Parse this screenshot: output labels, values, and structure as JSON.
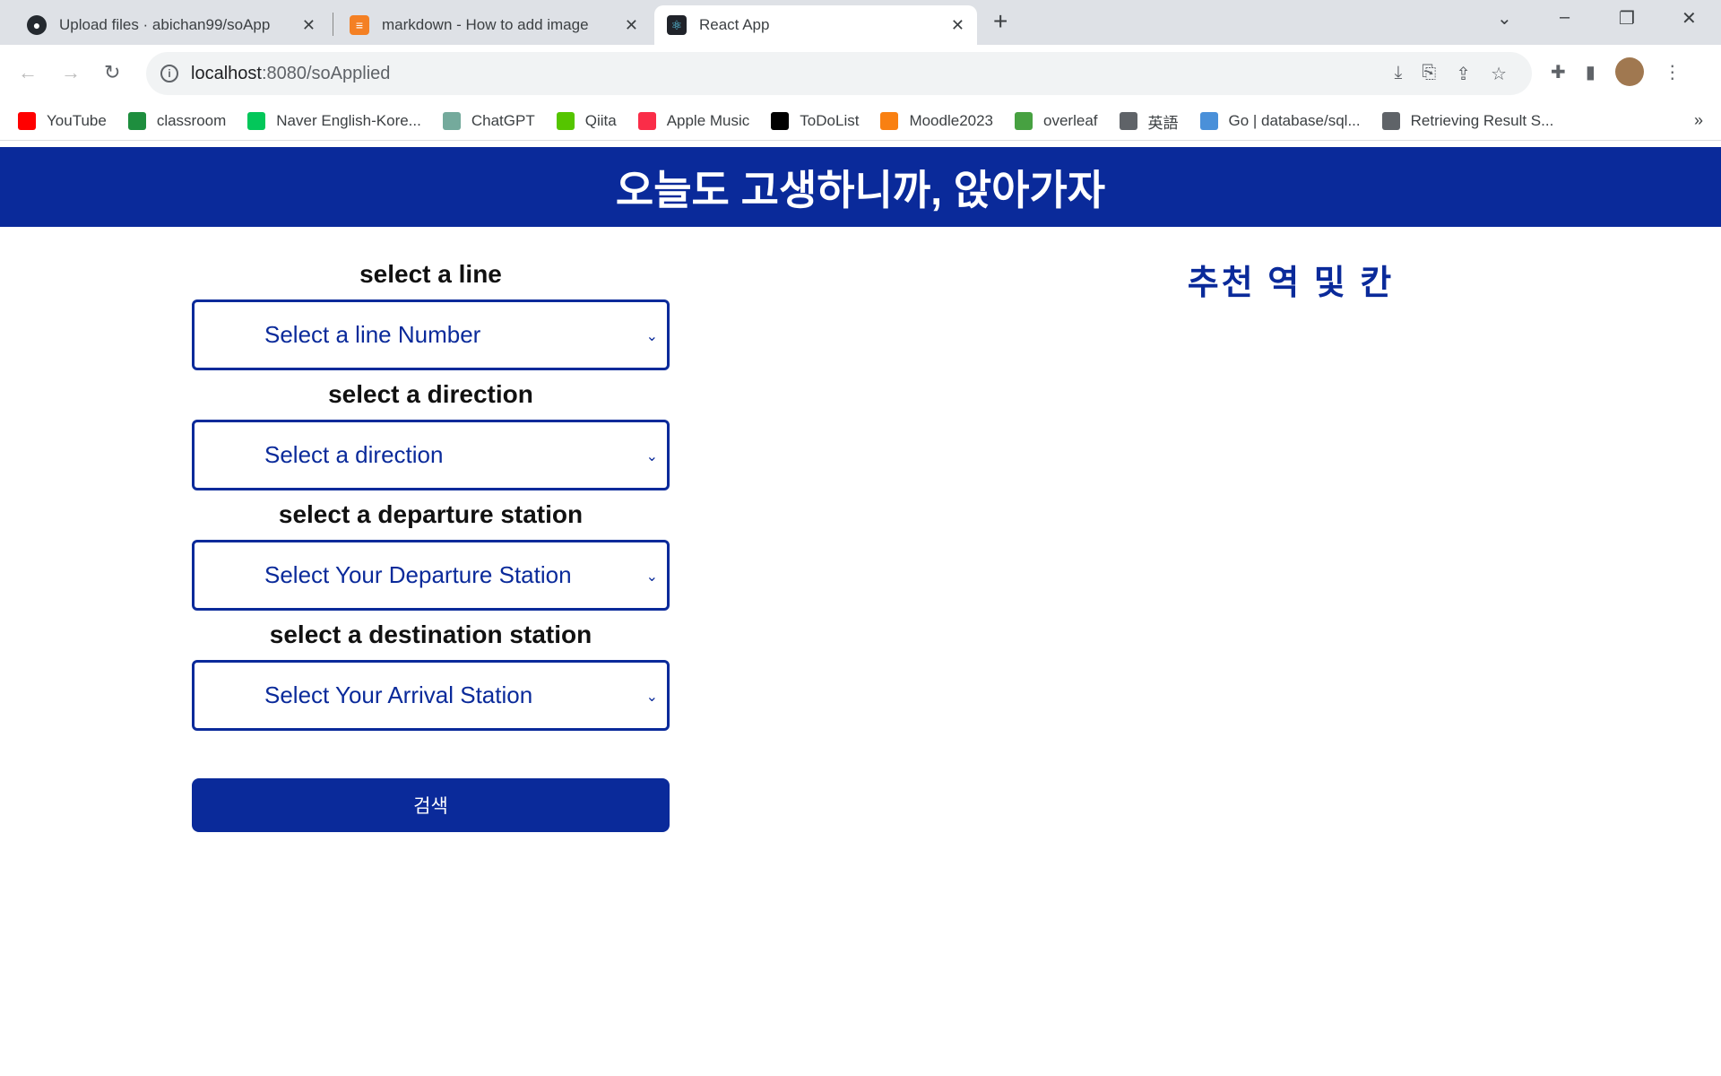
{
  "browser": {
    "tabs": [
      {
        "title": "Upload files · abichan99/soApp",
        "icon": "github-icon",
        "active": false
      },
      {
        "title": "markdown - How to add image",
        "icon": "stackoverflow-icon",
        "active": false
      },
      {
        "title": "React App",
        "icon": "react-icon",
        "active": true
      }
    ],
    "url_host": "localhost",
    "url_path": ":8080/soApplied",
    "bookmarks": [
      {
        "label": "YouTube",
        "color": "#ff0000"
      },
      {
        "label": "classroom",
        "color": "#1e8e3e"
      },
      {
        "label": "Naver English-Kore...",
        "color": "#03c75a"
      },
      {
        "label": "ChatGPT",
        "color": "#74aa9c"
      },
      {
        "label": "Qiita",
        "color": "#55c500"
      },
      {
        "label": "Apple Music",
        "color": "#fa2d48"
      },
      {
        "label": "ToDoList",
        "color": "#000000"
      },
      {
        "label": "Moodle2023",
        "color": "#f98012"
      },
      {
        "label": "overleaf",
        "color": "#47a141"
      },
      {
        "label": "英語",
        "color": "#5f6368"
      },
      {
        "label": "Go | database/sql...",
        "color": "#4a90d9"
      },
      {
        "label": "Retrieving Result S...",
        "color": "#5f6368"
      }
    ]
  },
  "app": {
    "header_title": "오늘도 고생하니까, 앉아가자",
    "accent": "#0a2a9a",
    "fields": [
      {
        "label": "select a line",
        "placeholder": "Select a line Number"
      },
      {
        "label": "select a direction",
        "placeholder": "Select a direction"
      },
      {
        "label": "select a departure station",
        "placeholder": "Select Your Departure Station"
      },
      {
        "label": "select a destination station",
        "placeholder": "Select Your Arrival Station"
      }
    ],
    "search_button": "검색",
    "recommend_title": "추천 역 및 칸"
  }
}
